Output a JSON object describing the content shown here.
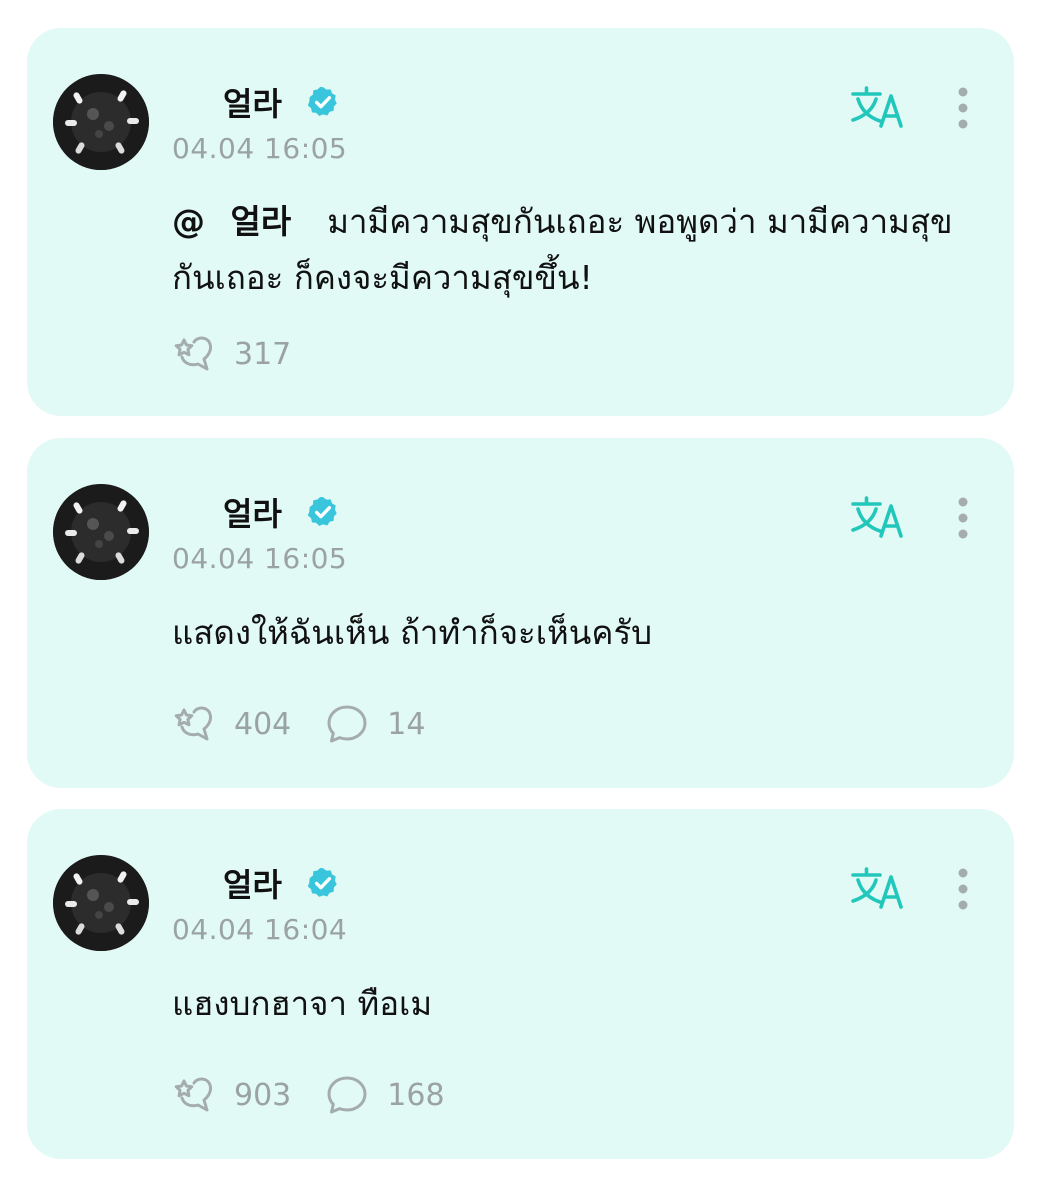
{
  "colors": {
    "card_background": "#e2faf6",
    "accent": "#22c7bb",
    "verified_badge": "#39c6dc",
    "muted_text": "#9aa3a2",
    "text": "#111111"
  },
  "posts": [
    {
      "author": "얼라",
      "verified": true,
      "timestamp": "04.04 16:05",
      "mention": "@ 얼라",
      "text": "มามีความสุขกันเถอะ พอพูดว่า มามีความสุขกันเถอะ ก็คงจะมีความสุขขึ้น!",
      "likes": "317"
    },
    {
      "author": "얼라",
      "verified": true,
      "timestamp": "04.04 16:05",
      "text": "แสดงให้ฉันเห็น ถ้าทำก็จะเห็นครับ",
      "likes": "404",
      "comments": "14"
    },
    {
      "author": "얼라",
      "verified": true,
      "timestamp": "04.04 16:04",
      "text": "แฮงบกฮาจา ทือเม",
      "likes": "903",
      "comments": "168"
    }
  ],
  "icons": {
    "verified": "verified-badge-icon",
    "translate": "translate-icon",
    "more": "more-vertical-icon",
    "like": "like-icon",
    "comment": "comment-icon"
  }
}
